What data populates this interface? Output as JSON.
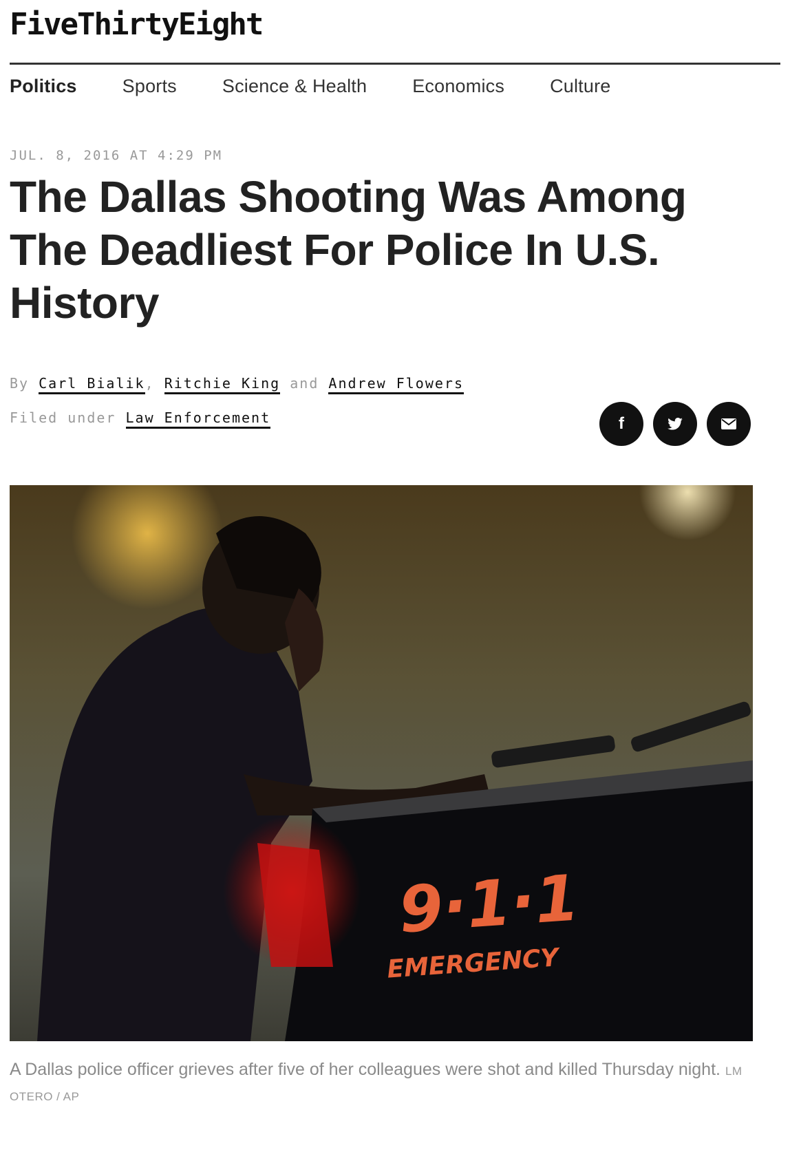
{
  "site": {
    "logo": "FiveThirtyEight"
  },
  "nav": {
    "items": [
      {
        "label": "Politics",
        "active": true
      },
      {
        "label": "Sports"
      },
      {
        "label": "Science & Health"
      },
      {
        "label": "Economics"
      },
      {
        "label": "Culture"
      }
    ]
  },
  "article": {
    "dateline": "JUL. 8, 2016 AT 4:29 PM",
    "headline": "The Dallas Shooting Was Among The Deadliest For Police In U.S. History",
    "byline": {
      "prefix": "By",
      "authors": [
        "Carl Bialik",
        "Ritchie King",
        "Andrew Flowers"
      ],
      "comma": ",",
      "and": "and"
    },
    "filed": {
      "prefix": "Filed under",
      "tag": "Law Enforcement"
    },
    "share": [
      {
        "icon": "facebook-icon",
        "glyph": "f"
      },
      {
        "icon": "twitter-icon"
      },
      {
        "icon": "email-icon"
      }
    ],
    "photo": {
      "vehicle_text_1": "9·1·1",
      "vehicle_text_2": "EMERGENCY"
    },
    "caption": {
      "text": "A Dallas police officer grieves after five of her colleagues were shot and killed Thursday night.",
      "credit": "LM OTERO / AP"
    }
  },
  "colors": {
    "text": "#222222",
    "muted": "#999999",
    "accent_photo_text": "#e8643a"
  }
}
